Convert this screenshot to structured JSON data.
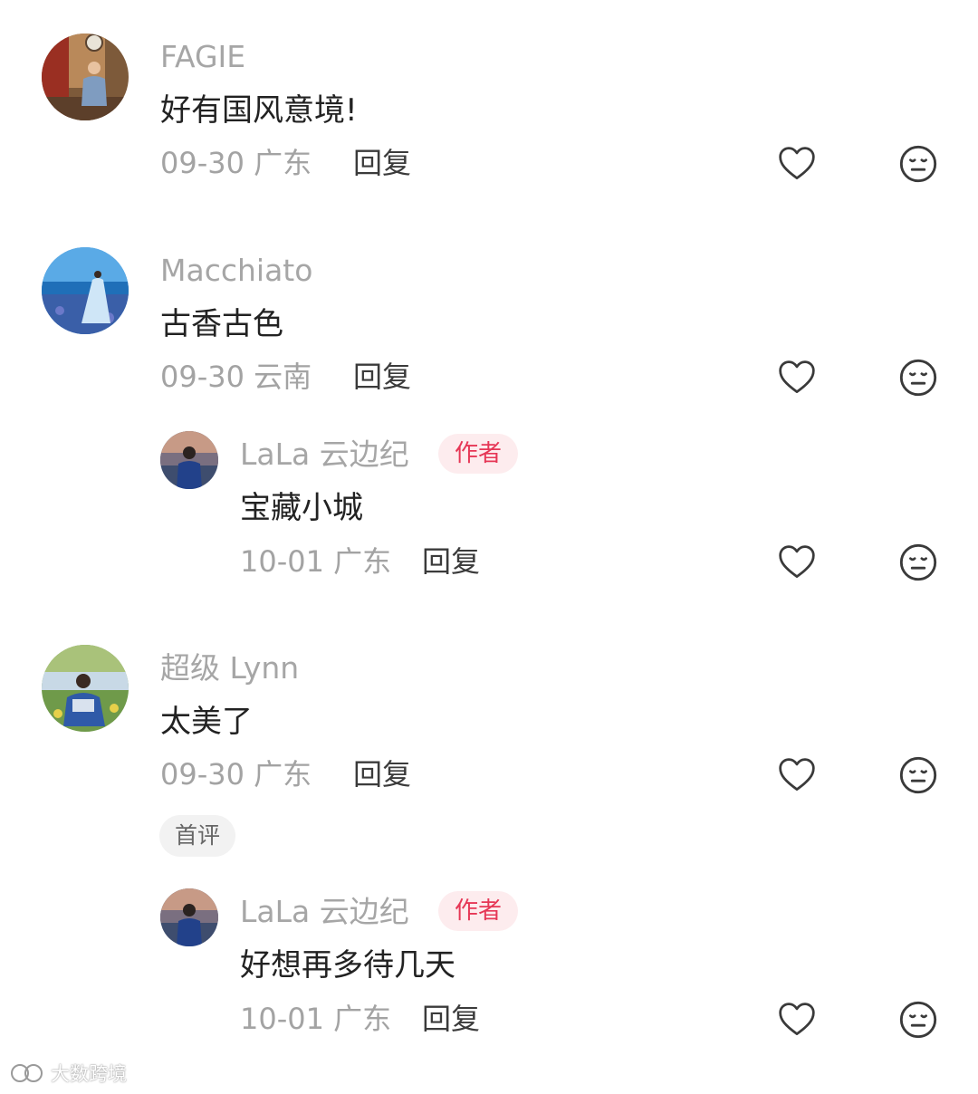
{
  "comments": [
    {
      "name": "FAGIE",
      "text": "好有国风意境!",
      "date": "09-30",
      "location": "广东",
      "reply_label": "回复"
    },
    {
      "name": "Macchiato",
      "text": "古香古色",
      "date": "09-30",
      "location": "云南",
      "reply_label": "回复",
      "replies": [
        {
          "name": "LaLa 云边纪",
          "badge": "作者",
          "text": "宝藏小城",
          "date": "10-01",
          "location": "广东",
          "reply_label": "回复"
        }
      ]
    },
    {
      "name": "超级 Lynn",
      "text": "太美了",
      "date": "09-30",
      "location": "广东",
      "reply_label": "回复",
      "tag": "首评",
      "replies": [
        {
          "name": "LaLa 云边纪",
          "badge": "作者",
          "text": "好想再多待几天",
          "date": "10-01",
          "location": "广东",
          "reply_label": "回复"
        }
      ]
    }
  ],
  "icons": {
    "like": "heart-outline-icon",
    "dislike": "neutral-face-icon"
  },
  "colors": {
    "author_badge_text": "#e63756",
    "author_badge_bg": "#fdecee",
    "name": "#a6a6a6",
    "text": "#222222"
  },
  "watermark": "大数跨境"
}
